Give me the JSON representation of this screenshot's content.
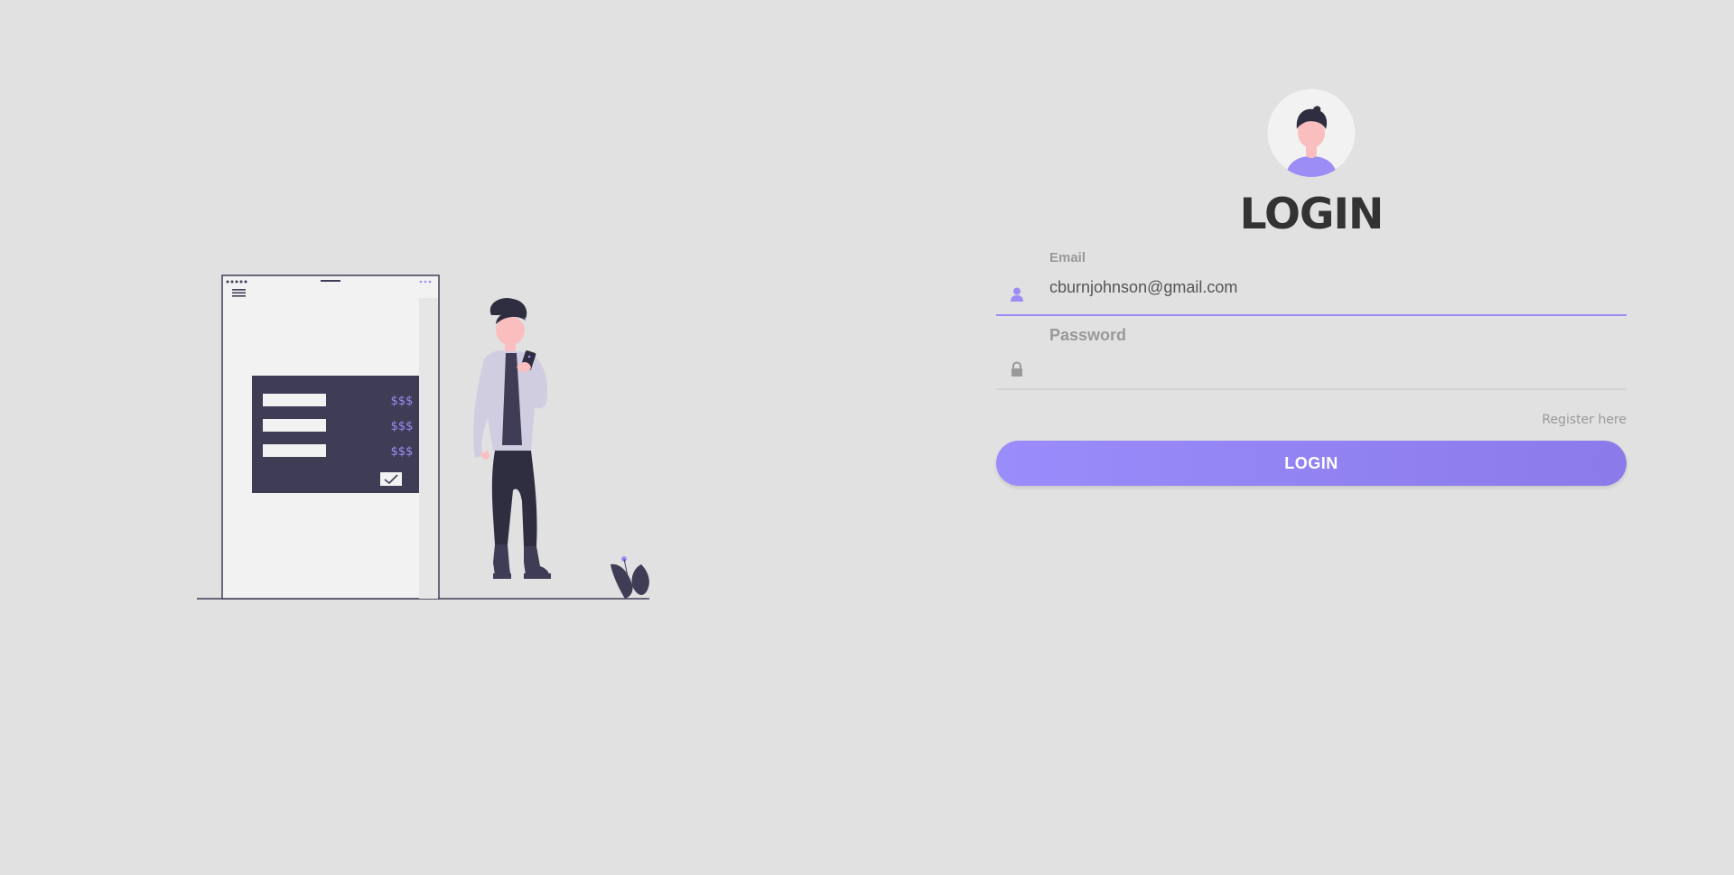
{
  "login": {
    "title": "LOGIN",
    "email": {
      "label": "Email",
      "value": "cburnjohnson@gmail.com",
      "icon": "user-icon"
    },
    "password": {
      "label": "Password",
      "value": "",
      "icon": "lock-icon"
    },
    "register_link": "Register here",
    "submit_label": "LOGIN"
  },
  "illustration": {
    "price_labels": [
      "$$$",
      "$$$",
      "$$$"
    ]
  },
  "colors": {
    "background": "#e1e1e1",
    "accent": "#9b8df5",
    "dark": "#3f3d56",
    "text": "#333333",
    "muted": "#999999"
  }
}
